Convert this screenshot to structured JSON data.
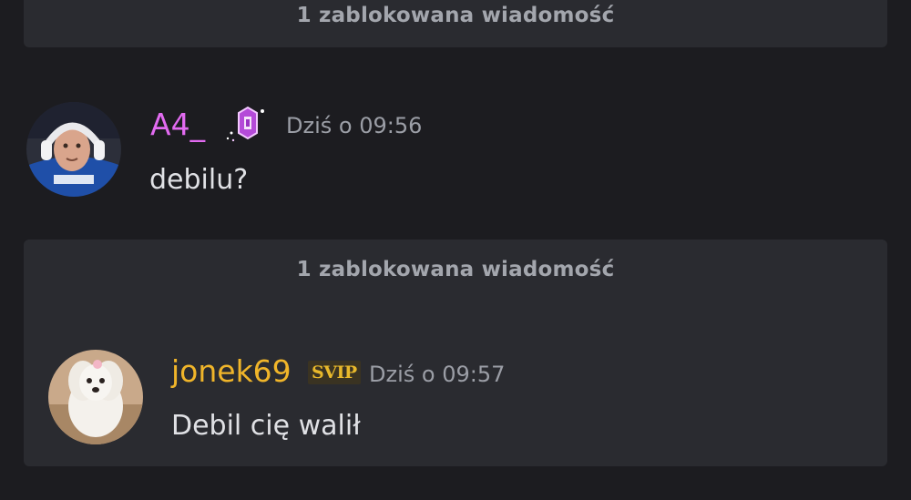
{
  "blocked_notices": [
    {
      "text": "1 zablokowana wiadomość"
    },
    {
      "text": "1 zablokowana wiadomość"
    }
  ],
  "messages": [
    {
      "username": "A4_",
      "username_color": "#e26bf1",
      "badge_icon": "nitro-gem-icon",
      "timestamp": "Dziś o 09:56",
      "text": "debilu?",
      "avatar": "avatar-person-headset"
    },
    {
      "username": "jonek69",
      "username_color": "#f0b52a",
      "badge_text": "SVIP",
      "timestamp": "Dziś o 09:57",
      "text": "Debil cię walił",
      "avatar": "avatar-white-dog"
    }
  ],
  "colors": {
    "background": "#1c1c20",
    "blocked_bg": "#2a2b30",
    "text": "#e0e1e5",
    "muted": "#9b9ea6"
  }
}
